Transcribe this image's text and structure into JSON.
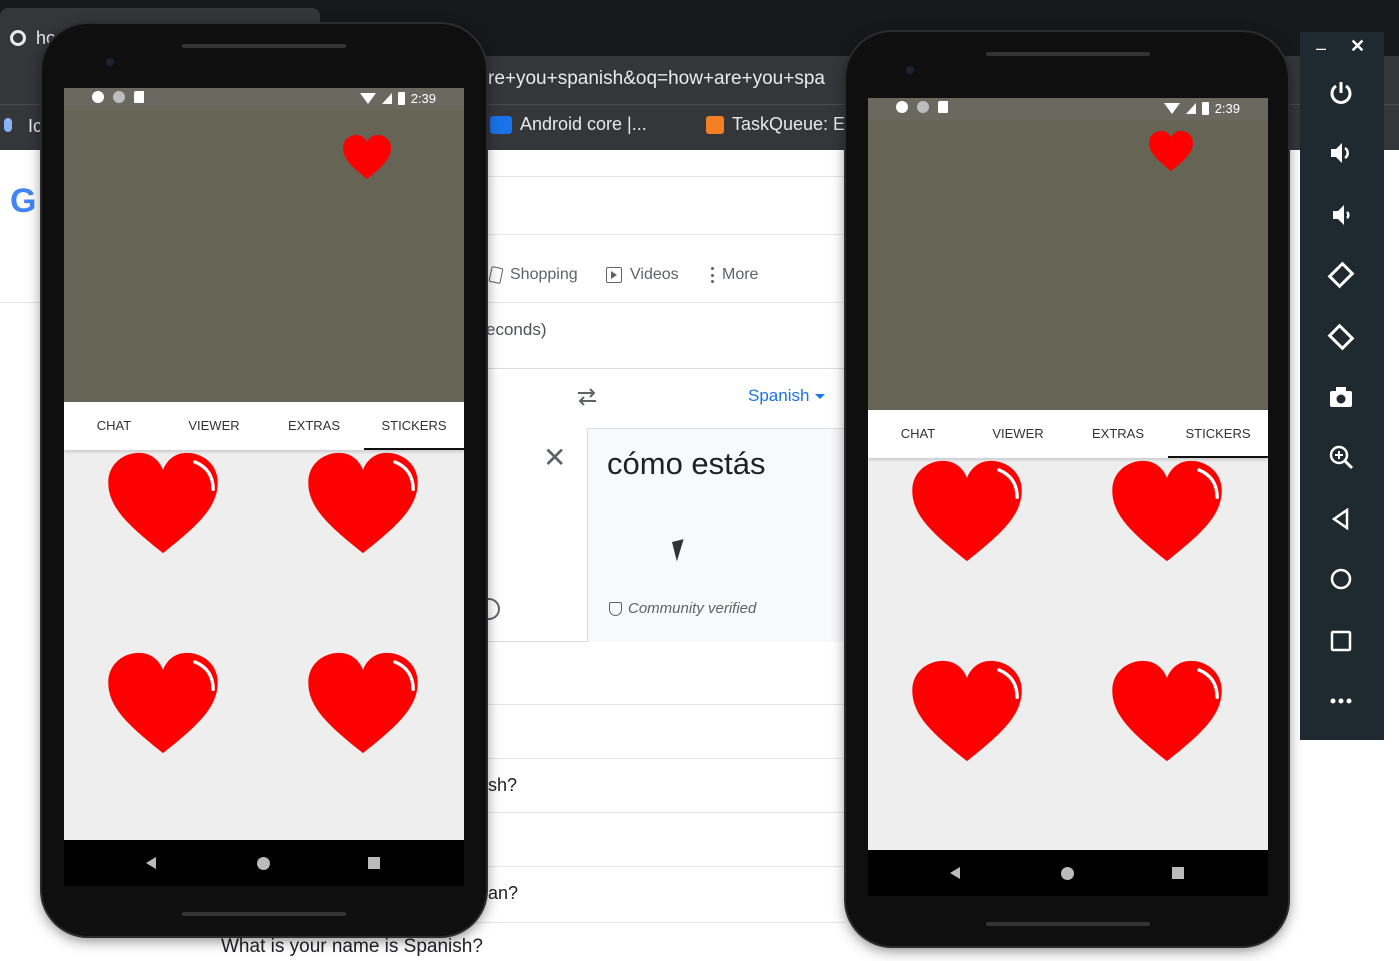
{
  "browser": {
    "tab_title": "ho",
    "url_fragment": "re+you+spanish&oq=how+are+you+spa",
    "bookmarks": [
      {
        "label": "Ic",
        "color": "#8ab4f8"
      },
      {
        "label": "Android core  |...",
        "color": "#1a73e8"
      },
      {
        "label": "TaskQueue: E",
        "color": "#f48024"
      }
    ],
    "google_logo_partial": "G"
  },
  "search": {
    "tabs": [
      {
        "label": "Shopping",
        "icon": "tag-icon"
      },
      {
        "label": "Videos",
        "icon": "play-icon"
      },
      {
        "label": "More",
        "icon": "more-vert-icon"
      }
    ],
    "stats_partial": "econds)",
    "translate": {
      "target_language": "Spanish",
      "translation": "cómo estás",
      "badge": "Community verified"
    },
    "related": [
      {
        "text": "sh?"
      },
      {
        "text": "an?"
      },
      {
        "text": "What is your name is Spanish?"
      }
    ]
  },
  "phones": [
    {
      "status": {
        "time": "2:39"
      },
      "tabs": [
        "CHAT",
        "VIEWER",
        "EXTRAS",
        "STICKERS"
      ],
      "selected_tab": "STICKERS",
      "stickers": [
        "heart",
        "heart",
        "heart",
        "heart"
      ]
    },
    {
      "status": {
        "time": "2:39"
      },
      "tabs": [
        "CHAT",
        "VIEWER",
        "EXTRAS",
        "STICKERS"
      ],
      "selected_tab": "STICKERS",
      "stickers": [
        "heart",
        "heart",
        "heart",
        "heart"
      ]
    }
  ],
  "emulator_toolbar": {
    "window_controls": [
      "minimize-icon",
      "close-icon"
    ],
    "buttons": [
      "power-icon",
      "volume-up-icon",
      "volume-down-icon",
      "rotate-left-icon",
      "rotate-right-icon",
      "camera-icon",
      "zoom-icon",
      "back-icon",
      "home-icon",
      "overview-icon",
      "more-icon"
    ]
  },
  "colors": {
    "app_header": "#666555",
    "heart": "#ff0000",
    "toolbar": "#1e2a30",
    "accent_blue": "#1a73e8"
  }
}
